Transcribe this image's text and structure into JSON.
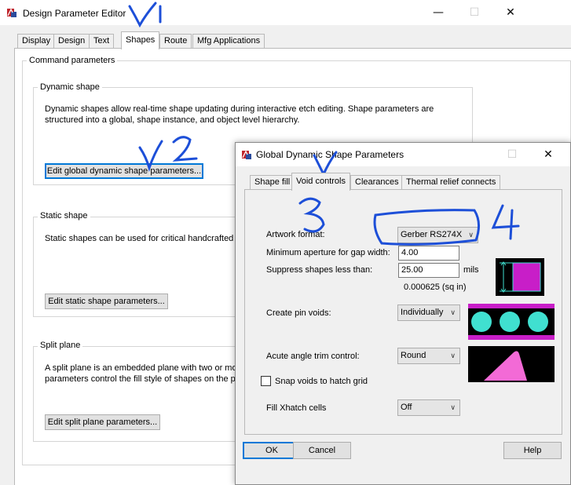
{
  "main_window": {
    "title": "Design Parameter Editor",
    "tabs": [
      "Display",
      "Design",
      "Text",
      "Shapes",
      "Route",
      "Mfg Applications"
    ],
    "active_tab": "Shapes",
    "command_parameters_label": "Command parameters",
    "dynamic_shape": {
      "label": "Dynamic shape",
      "description_line1": "Dynamic shapes allow real-time shape updating during interactive etch editing.  Shape parameters are",
      "description_line2": "structured into a global, shape instance, and object level hierarchy.",
      "button": "Edit global dynamic shape parameters..."
    },
    "static_shape": {
      "label": "Static shape",
      "description_line1": "Static shapes can be used for critical handcrafted e",
      "button": "Edit static shape parameters..."
    },
    "split_plane": {
      "label": "Split plane",
      "description_line1": "A split plane is an embedded plane with two or more",
      "description_line2": "parameters control the fill style of shapes on the pla",
      "button": "Edit split plane parameters..."
    }
  },
  "dialog": {
    "title": "Global Dynamic Shape Parameters",
    "tabs": [
      "Shape fill",
      "Void controls",
      "Clearances",
      "Thermal relief connects"
    ],
    "active_tab": "Void controls",
    "artwork_format": {
      "label": "Artwork format:",
      "value": "Gerber RS274X"
    },
    "min_aperture": {
      "label": "Minimum aperture for gap width:",
      "value": "4.00"
    },
    "suppress": {
      "label": "Suppress shapes less than:",
      "value": "25.00",
      "unit": "mils",
      "area": "0.000625 (sq in)"
    },
    "pin_voids": {
      "label": "Create pin voids:",
      "value": "Individually"
    },
    "acute_angle": {
      "label": "Acute angle trim control:",
      "value": "Round"
    },
    "snap_voids": {
      "label": "Snap voids to hatch grid",
      "checked": false
    },
    "fill_xhatch": {
      "label": "Fill Xhatch cells",
      "value": "Off"
    },
    "ok": "OK",
    "cancel": "Cancel",
    "help": "Help"
  },
  "annotations": {
    "mark_1": "✓1",
    "mark_2": "✓2",
    "mark_3": "3",
    "mark_4": "4",
    "mark_v": "✓",
    "color": "#1d4fd8"
  },
  "colors": {
    "preview_magenta": "#c81ec8",
    "preview_cyan": "#40e0d0",
    "preview_pink": "#f36ad6",
    "focus_blue": "#0078d7"
  }
}
